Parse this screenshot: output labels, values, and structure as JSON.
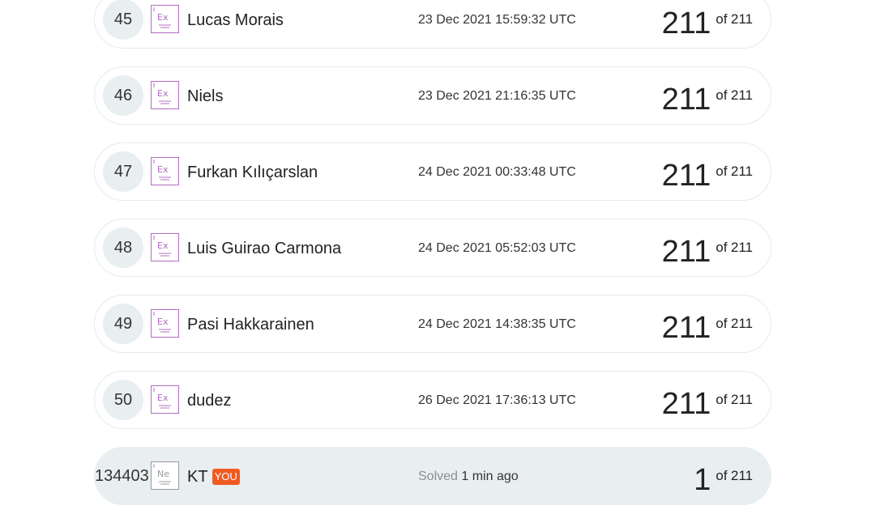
{
  "leaderboard": {
    "rows": [
      {
        "rank": "45",
        "name": "Lucas Morais",
        "time": "23 Dec 2021 15:59:32 UTC",
        "score": "211",
        "of_label": "of",
        "total": "211",
        "badge": "Ex"
      },
      {
        "rank": "46",
        "name": "Niels",
        "time": "23 Dec 2021 21:16:35 UTC",
        "score": "211",
        "of_label": "of",
        "total": "211",
        "badge": "Ex"
      },
      {
        "rank": "47",
        "name": "Furkan Kılıçarslan",
        "time": "24 Dec 2021 00:33:48 UTC",
        "score": "211",
        "of_label": "of",
        "total": "211",
        "badge": "Ex"
      },
      {
        "rank": "48",
        "name": "Luis Guirao Carmona",
        "time": "24 Dec 2021 05:52:03 UTC",
        "score": "211",
        "of_label": "of",
        "total": "211",
        "badge": "Ex"
      },
      {
        "rank": "49",
        "name": "Pasi Hakkarainen",
        "time": "24 Dec 2021 14:38:35 UTC",
        "score": "211",
        "of_label": "of",
        "total": "211",
        "badge": "Ex"
      },
      {
        "rank": "50",
        "name": "dudez",
        "time": "26 Dec 2021 17:36:13 UTC",
        "score": "211",
        "of_label": "of",
        "total": "211",
        "badge": "Ex"
      }
    ],
    "you_row": {
      "rank": "134403",
      "name": "KT",
      "you_tag": "YOU",
      "solved_label": "Solved",
      "solved_ago": "1 min ago",
      "score": "1",
      "of_label": "of",
      "total": "211",
      "badge": "Ne"
    }
  },
  "colors": {
    "badge_expert": "#b06cc2",
    "badge_newbie": "#9a9a9a",
    "you_tag": "#f15a22",
    "you_row_bg": "#e9eef1"
  }
}
